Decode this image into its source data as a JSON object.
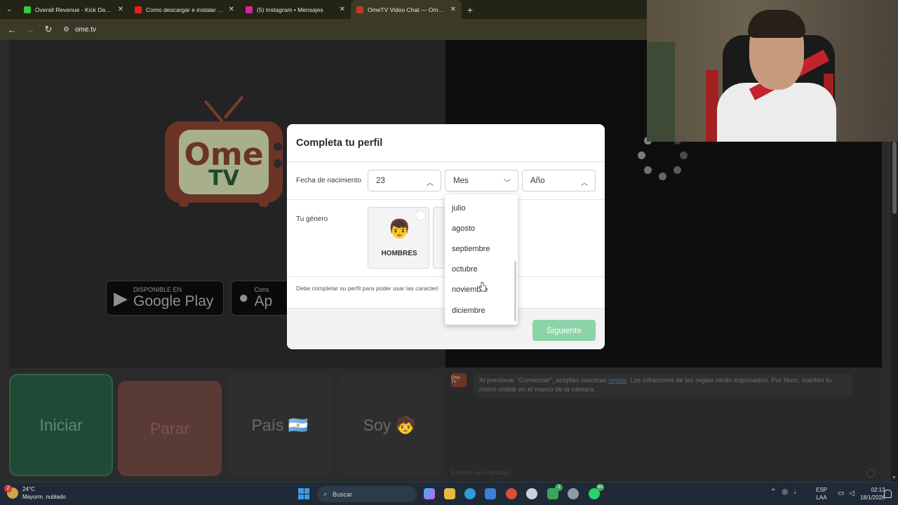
{
  "browser": {
    "tabs": [
      {
        "title": "Overall Revenue - Kick Dashbo...",
        "favicon_color": "#2ecc40"
      },
      {
        "title": "Como descargar e instalar PES...",
        "favicon_color": "#e62117"
      },
      {
        "title": "(5) Instagram • Mensajes",
        "favicon_color": "#d6249f"
      },
      {
        "title": "OmeTV Video Chat — Omegle...",
        "favicon_color": "#c0392b",
        "active": true
      }
    ],
    "close_glyph": "✕",
    "new_tab_glyph": "+",
    "url": "ome.tv"
  },
  "ometv": {
    "logo_top": "Ome",
    "logo_bottom": "TV",
    "google_play_small": "DISPONIBLE EN",
    "google_play_big": "Google Play",
    "app_store_small": "Cons",
    "app_store_big": "Ap",
    "buttons": {
      "start": "Iniciar",
      "stop": "Parar",
      "country": "País 🇦🇷",
      "iam": "Soy 🧒"
    },
    "chat": {
      "avatar_text": "Ome TV",
      "message_before": "Al presionar \"Comenzar\", aceptas nuestras ",
      "message_link": "reglas",
      "message_after": ". Los infractores de las reglas serán expulsados. Por favor, mantén tu rostro visible en el marco de la cámara.",
      "input_placeholder": "Escribe un mensaje"
    }
  },
  "modal": {
    "title": "Completa tu perfil",
    "birth_label": "Fecha de nacimiento",
    "day_value": "23",
    "month_value": "Mes",
    "year_value": "Año",
    "gender_label": "Tu género",
    "gender_men": "HOMBRES",
    "hint": "Debe completar su perfil para poder usar las caracterí",
    "next_button": "Siguiente",
    "month_options": [
      "julio",
      "agosto",
      "septiembre",
      "octubre",
      "noviembre",
      "diciembre"
    ]
  },
  "taskbar": {
    "temperature": "24°C",
    "weather": "Mayorm. nublado",
    "weather_badge": "2",
    "search_placeholder": "Buscar",
    "lang_1": "ESP",
    "lang_2": "LAA",
    "time": "02:13",
    "date": "18/1/2026",
    "badge_xbox": "3",
    "badge_whatsapp": "60"
  },
  "colors": {
    "modal_next": "#8cd3a7",
    "start_button": "#204a35",
    "stop_button": "#5a3a35"
  }
}
